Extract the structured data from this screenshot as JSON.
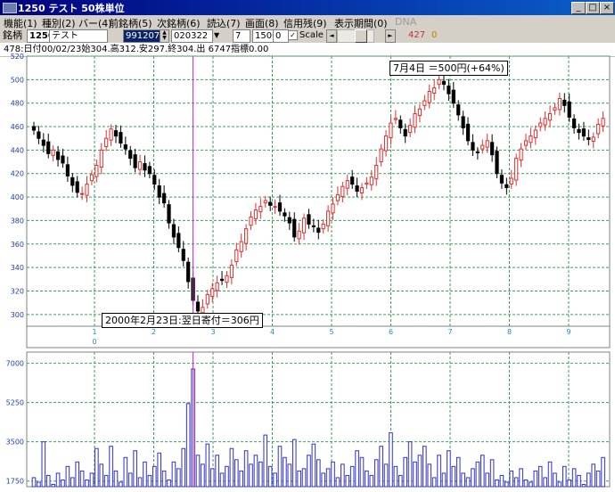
{
  "window": {
    "title": "1250 テスト  50株単位",
    "minimize": "_",
    "maximize": "□",
    "close": "×"
  },
  "menu": [
    {
      "label": "機能(1)",
      "enabled": true
    },
    {
      "label": "種別(2)",
      "enabled": true
    },
    {
      "label": "バー(4)",
      "enabled": true
    },
    {
      "label": "前銘柄(5)",
      "enabled": true
    },
    {
      "label": "次銘柄(6)",
      "enabled": true
    },
    {
      "label": "読込(7)",
      "enabled": true
    },
    {
      "label": "画面(8)",
      "enabled": true
    },
    {
      "label": "信用残(9)",
      "enabled": true
    },
    {
      "label": "表示期間(0)",
      "enabled": true
    },
    {
      "label": "DNA",
      "enabled": false
    }
  ],
  "toolbar": {
    "ticker_label": "銘柄",
    "ticker_code": "1250",
    "ticker_name": "テスト",
    "start_date": "991207",
    "end_date": "020322",
    "field_a": "7",
    "field_b": "1500",
    "field_c": "0",
    "scale_label": "Scale",
    "scale_checked": true,
    "scroll_left": "◄",
    "scroll_right": "►",
    "count": "427",
    "count_extra": "0"
  },
  "info_line": "478:日付00/02/23始304.高312.安297.終304.出 6747指標0.00",
  "annotations": {
    "high": "7月4日 ＝500円(+64%)",
    "low": "2000年2月23日:翌日寄付＝306円"
  },
  "colors": {
    "grid": "#3aa05a",
    "up_candle": "#e03030",
    "down_candle": "#000000",
    "volume_bar": "#3030d0",
    "cursor": "#d020d0"
  },
  "chart_data": [
    {
      "type": "candlestick",
      "title": "",
      "ylim": [
        290,
        520
      ],
      "y_ticks": [
        300,
        320,
        340,
        360,
        380,
        400,
        420,
        440,
        460,
        480,
        500,
        520
      ],
      "x_tick_labels": [
        "1",
        "2",
        "3",
        "4",
        "5",
        "6",
        "7",
        "8",
        "9"
      ],
      "x_sub_label": "0",
      "cursor_date": "00/02/23",
      "close": [
        457,
        450,
        444,
        437,
        440,
        432,
        429,
        418,
        410,
        404,
        403,
        411,
        419,
        427,
        440,
        450,
        458,
        452,
        446,
        441,
        433,
        425,
        430,
        423,
        420,
        411,
        400,
        395,
        378,
        366,
        357,
        346,
        328,
        312,
        303,
        306,
        317,
        322,
        327,
        329,
        333,
        342,
        355,
        362,
        373,
        383,
        389,
        392,
        397,
        393,
        392,
        388,
        384,
        378,
        366,
        371,
        382,
        377,
        375,
        370,
        377,
        388,
        394,
        402,
        409,
        414,
        411,
        405,
        408,
        412,
        417,
        427,
        441,
        452,
        463,
        467,
        459,
        452,
        461,
        471,
        475,
        482,
        490,
        493,
        500,
        496,
        488,
        480,
        470,
        459,
        448,
        440,
        438,
        444,
        448,
        436,
        420,
        412,
        408,
        416,
        433,
        441,
        448,
        452,
        457,
        463,
        467,
        471,
        476,
        484,
        478,
        468,
        459,
        455,
        452,
        449,
        451,
        462,
        467
      ]
    },
    {
      "type": "bar",
      "title": "",
      "ylim": [
        1500,
        7500
      ],
      "y_ticks": [
        1750,
        3500,
        5250,
        7000
      ],
      "values": [
        1900,
        1700,
        3500,
        2000,
        1600,
        2100,
        1800,
        2400,
        1900,
        2600,
        2200,
        1800,
        2100,
        3200,
        2500,
        2000,
        3300,
        2200,
        1700,
        2800,
        2100,
        3100,
        1900,
        2600,
        2000,
        2400,
        3000,
        2200,
        1800,
        2600,
        2300,
        3200,
        5200,
        6747,
        2900,
        2500,
        3400,
        2300,
        2900,
        2100,
        2400,
        3200,
        2700,
        2200,
        3100,
        2500,
        2900,
        2600,
        3800,
        2400,
        2100,
        3300,
        2800,
        2500,
        3600,
        2200,
        2300,
        2900,
        3400,
        2700,
        2100,
        2300,
        2600,
        1900,
        2500,
        2000,
        2400,
        3100,
        2800,
        2200,
        2000,
        2700,
        3300,
        2500,
        3900,
        2400,
        2000,
        2800,
        3500,
        2600,
        2900,
        3300,
        2500,
        1900,
        2900,
        2100,
        3100,
        2400,
        2800,
        2100,
        1900,
        2300,
        2600,
        2900,
        2100,
        2700,
        1800,
        2000,
        1700,
        2200,
        1900,
        2300,
        1800,
        1700,
        2200,
        2400,
        1900,
        2600,
        2100,
        1700,
        2400,
        1800,
        2300,
        2000,
        1600,
        2100,
        2500,
        2200,
        2800
      ]
    }
  ]
}
